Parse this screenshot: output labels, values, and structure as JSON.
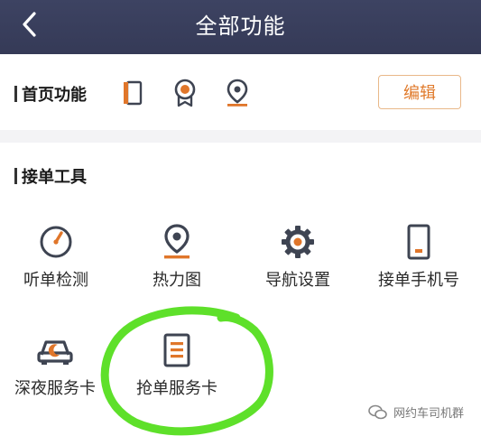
{
  "header": {
    "title": "全部功能",
    "back_icon": "chevron-left-icon"
  },
  "home_section": {
    "title": "首页功能",
    "icons": [
      "phone-card-icon",
      "badge-icon",
      "location-pin-icon"
    ],
    "edit_label": "编辑"
  },
  "tools_section": {
    "title": "接单工具",
    "items": [
      {
        "label": "听单检测",
        "icon": "gauge-icon"
      },
      {
        "label": "热力图",
        "icon": "map-pin-icon"
      },
      {
        "label": "导航设置",
        "icon": "gear-icon"
      },
      {
        "label": "接单手机号",
        "icon": "phone-icon"
      },
      {
        "label": "深夜服务卡",
        "icon": "night-car-icon"
      },
      {
        "label": "抢单服务卡",
        "icon": "order-card-icon"
      }
    ]
  },
  "watermark": {
    "text": "网约车司机群"
  },
  "colors": {
    "navbar": "#3d4362",
    "accent_orange": "#e0762a",
    "icon_dark": "#3e4452",
    "annotation_green": "#5ee02a"
  }
}
